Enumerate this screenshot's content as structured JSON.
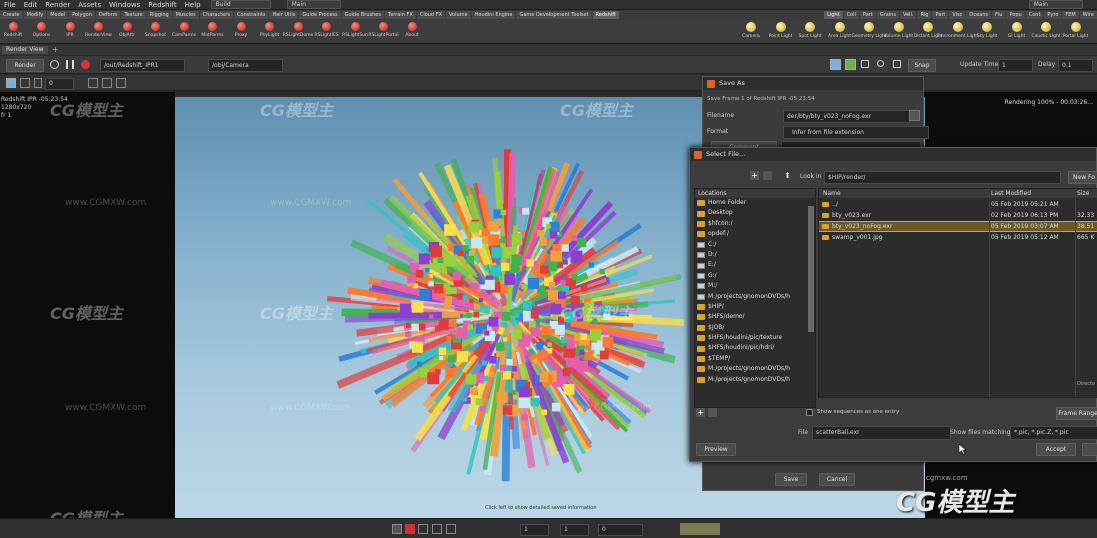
{
  "menubar": {
    "items": [
      "File",
      "Edit",
      "Render",
      "Assets",
      "Windows",
      "Redshift",
      "Help"
    ],
    "build_label": "Build",
    "desktop_label": "Main",
    "right_desktop_label": "Main"
  },
  "shelf": {
    "tabs": [
      "Create",
      "Modify",
      "Model",
      "Polygon",
      "Deform",
      "Texture",
      "Rigging",
      "Muscles",
      "Characters",
      "Constraints",
      "Hair Utils",
      "Guide Process",
      "Guide Brushes",
      "Terrain FX",
      "Cloud FX",
      "Volume",
      "Houdini Engine",
      "Game Development Toolset",
      "Redshift"
    ],
    "tools": [
      "Redshift",
      "Options",
      "IPR",
      "RenderView",
      "ObjAttr",
      "Snapshot",
      "CamParms",
      "MatParms",
      "Proxy",
      "PhyLight",
      "RSLightDome",
      "RSLightIES",
      "RSLightSun",
      "RSLightPortal",
      "About"
    ],
    "light_tabs": [
      "Light",
      "Coll",
      "Part",
      "Grains",
      "Vell.",
      "Rig",
      "Part",
      "Visc",
      "Oceans",
      "Flu",
      "Popu",
      "Cont",
      "Pyro",
      "FEM",
      "Wire"
    ],
    "light_tools": [
      "Camera",
      "Point Light",
      "Spot Light",
      "Area Light",
      "Geometry Light",
      "Volume Light",
      "Distant Light",
      "Environment Light",
      "Sky Light",
      "GI Light",
      "Caustic Light",
      "Portal Light"
    ]
  },
  "render_view": {
    "tab_label": "Render View",
    "render_button": "Render",
    "renderer": "/out/Redshift_IPR1",
    "camera": "/obj/Camera",
    "snap_button": "Snap",
    "update_time_label": "Update Time",
    "update_time": "1",
    "delay_label": "Delay",
    "delay": "0.1",
    "frame_field": "0",
    "info_left": "Redshift IPR -05:23:54",
    "resolution": "1280x720",
    "frame_info": "fr 1",
    "rendering_status": "Rendering 100% - 00:03:26...",
    "footer_hint": "Click left to show detailed saved information"
  },
  "watermarks": {
    "brand": "CG模型主",
    "url": "www.CGMXW.com",
    "logo_small": "cgmxw.com"
  },
  "save_dialog": {
    "title": "Save As",
    "frame_info": "Save Frame 1 of Redshift IPR -05:23:54",
    "filename_label": "Filename",
    "filename": "der/bty/bty_v023_noFog.exr",
    "format_label": "Format",
    "format": "Infer from file extension",
    "comment_label": "Comment",
    "save_button": "Save",
    "cancel_button": "Cancel"
  },
  "select_dialog": {
    "title": "Select File...",
    "look_in_label": "Look in",
    "look_in": "$HIP/render/",
    "new_folder_button": "New Fo",
    "locations_header": "Locations",
    "locations": [
      {
        "label": "Home Folder",
        "icon": "folder"
      },
      {
        "label": "Desktop",
        "icon": "folder"
      },
      {
        "label": "$hfcon:/",
        "icon": "folder"
      },
      {
        "label": "opdef:/",
        "icon": "folder"
      },
      {
        "label": "C:/",
        "icon": "drive"
      },
      {
        "label": "D:/",
        "icon": "drive"
      },
      {
        "label": "E:/",
        "icon": "drive"
      },
      {
        "label": "G:/",
        "icon": "drive"
      },
      {
        "label": "M:/",
        "icon": "drive"
      },
      {
        "label": "M:/projects/gnomonDVDs/h",
        "icon": "drive"
      },
      {
        "label": "$HIP/",
        "icon": "folder"
      },
      {
        "label": "$HFS/demo/",
        "icon": "folder"
      },
      {
        "label": "$JOB/",
        "icon": "folder"
      },
      {
        "label": "$HFS/houdini/pic/texture",
        "icon": "folder"
      },
      {
        "label": "$HFS/houdini/pic/hdri/",
        "icon": "folder"
      },
      {
        "label": "$TEMP/",
        "icon": "folder"
      },
      {
        "label": "M:/projects/gnomonDVDs/h",
        "icon": "folder"
      },
      {
        "label": "M:/projects/gnomonDVDs/h",
        "icon": "folder"
      }
    ],
    "columns": {
      "name": "Name",
      "modified": "Last Modified",
      "size": "Size"
    },
    "files": [
      {
        "name": "../",
        "modified": "05 Feb 2019 05:21 AM",
        "size": "",
        "selected": false
      },
      {
        "name": "bty_v023.exr",
        "modified": "02 Feb 2019 06:13 PM",
        "size": "32.33",
        "selected": false
      },
      {
        "name": "bty_v023_noFog.exr",
        "modified": "05 Feb 2019 03:07 AM",
        "size": "38.51",
        "selected": true
      },
      {
        "name": "swamp_v001.jpg",
        "modified": "05 Feb 2019 05:12 AM",
        "size": "665 K",
        "selected": false
      }
    ],
    "show_sequences_label": "Show sequences as one entry",
    "preview_button": "Preview",
    "file_label": "File",
    "file_value": "scatterBall.exr",
    "show_files_label": "Show files matching",
    "file_pattern": "*.pic, *.pic.Z, *.pic",
    "frame_range_button": "Frame Range",
    "accept_button": "Accept",
    "side_label": "Directo"
  },
  "status_bar": {
    "frame": "1",
    "field_a": "1",
    "field_b": "0"
  }
}
